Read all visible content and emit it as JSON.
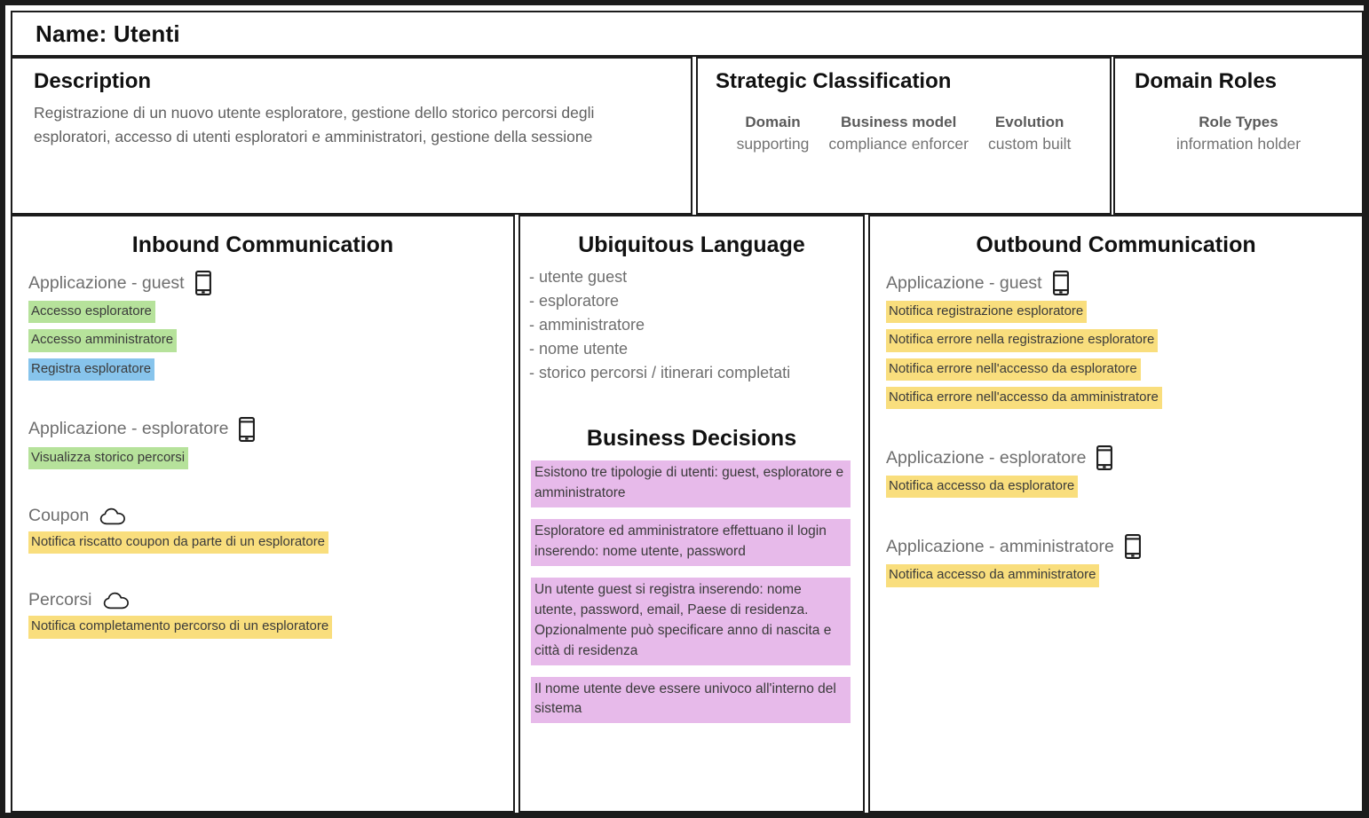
{
  "name_row": {
    "label": "Name: Utenti"
  },
  "description": {
    "title": "Description",
    "text": "Registrazione di un nuovo utente esploratore, gestione dello storico percorsi degli esploratori, accesso di utenti esploratori e amministratori, gestione della sessione"
  },
  "strategic_classification": {
    "title": "Strategic Classification",
    "columns": [
      {
        "key": "Domain",
        "value": "supporting"
      },
      {
        "key": "Business model",
        "value": "compliance enforcer"
      },
      {
        "key": "Evolution",
        "value": "custom built"
      }
    ]
  },
  "domain_roles": {
    "title": "Domain Roles",
    "key": "Role Types",
    "value": "information holder"
  },
  "inbound": {
    "title": "Inbound Communication",
    "groups": [
      {
        "label": "Applicazione - guest",
        "icon": "mobile-icon",
        "messages": [
          {
            "text": "Accesso esploratore",
            "color": "green"
          },
          {
            "text": "Accesso amministratore",
            "color": "green"
          },
          {
            "text": "Registra esploratore",
            "color": "blue"
          }
        ]
      },
      {
        "label": "Applicazione - esploratore",
        "icon": "mobile-icon",
        "messages": [
          {
            "text": "Visualizza storico percorsi",
            "color": "green"
          }
        ]
      },
      {
        "label": "Coupon",
        "icon": "cloud-icon",
        "messages": [
          {
            "text": "Notifica riscatto coupon da parte di un esploratore",
            "color": "yellow"
          }
        ]
      },
      {
        "label": "Percorsi",
        "icon": "cloud-icon",
        "messages": [
          {
            "text": "Notifica completamento percorso di un esploratore",
            "color": "yellow"
          }
        ]
      }
    ]
  },
  "ubiquitous_language": {
    "title": "Ubiquitous Language",
    "terms": [
      "- utente guest",
      "- esploratore",
      "- amministratore",
      "- nome utente",
      "- storico percorsi / itinerari completati"
    ]
  },
  "business_decisions": {
    "title": "Business Decisions",
    "items": [
      "Esistono tre tipologie di utenti: guest, esploratore e amministratore",
      "Esploratore ed amministratore effettuano il login inserendo: nome utente, password",
      "Un utente guest si registra inserendo: nome utente, password, email, Paese di residenza. Opzionalmente può specificare anno di nascita e città di residenza",
      "Il nome utente deve essere univoco all'interno del sistema"
    ]
  },
  "outbound": {
    "title": "Outbound Communication",
    "groups": [
      {
        "label": "Applicazione - guest",
        "icon": "mobile-icon",
        "messages": [
          {
            "text": "Notifica registrazione esploratore",
            "color": "yellow"
          },
          {
            "text": "Notifica errore nella registrazione esploratore",
            "color": "yellow"
          },
          {
            "text": "Notifica errore nell'accesso da esploratore",
            "color": "yellow"
          },
          {
            "text": "Notifica errore nell'accesso da amministratore",
            "color": "yellow"
          }
        ]
      },
      {
        "label": "Applicazione - esploratore",
        "icon": "mobile-icon",
        "messages": [
          {
            "text": "Notifica accesso da esploratore",
            "color": "yellow"
          }
        ]
      },
      {
        "label": "Applicazione - amministratore",
        "icon": "mobile-icon",
        "messages": [
          {
            "text": "Notifica accesso da amministratore",
            "color": "yellow"
          }
        ]
      }
    ]
  },
  "colors": {
    "green": "#b6e29b",
    "blue": "#87c4ec",
    "yellow": "#f9de7d",
    "purple": "#e7baea",
    "border": "#1c1c1c"
  }
}
